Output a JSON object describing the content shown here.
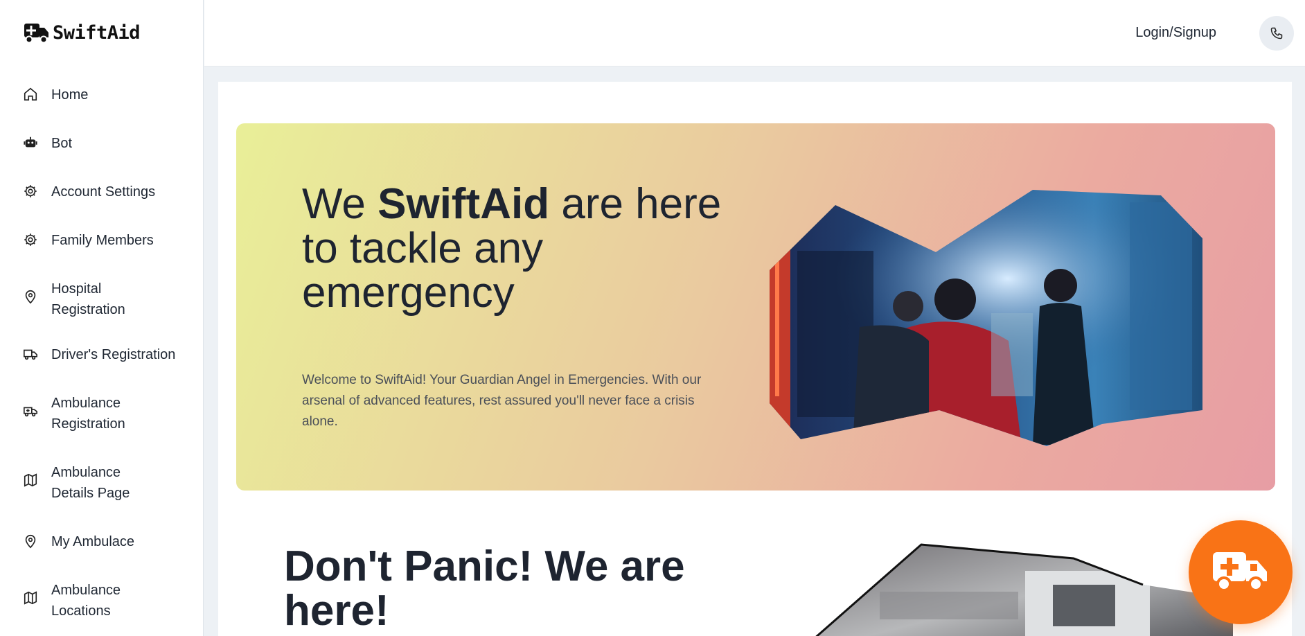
{
  "app": {
    "name": "SwiftAid",
    "brand_color": "#f97316"
  },
  "sidebar": {
    "items": [
      {
        "label": "Home",
        "icon": "home-icon"
      },
      {
        "label": "Bot",
        "icon": "bot-icon"
      },
      {
        "label": "Account Settings",
        "icon": "gear-icon"
      },
      {
        "label": "Family Members",
        "icon": "gear-icon"
      },
      {
        "label": "Hospital Registration",
        "icon": "map-pin-icon"
      },
      {
        "label": "Driver's Registration",
        "icon": "truck-icon"
      },
      {
        "label": "Ambulance Registration",
        "icon": "ambulance-icon"
      },
      {
        "label": "Ambulance Details Page",
        "icon": "map-icon"
      },
      {
        "label": "My Ambulace",
        "icon": "map-pin-icon"
      },
      {
        "label": "Ambulance Locations",
        "icon": "map-icon"
      }
    ]
  },
  "topbar": {
    "login_label": "Login/Signup",
    "phone_icon": "phone-icon"
  },
  "hero": {
    "title_pre": "We ",
    "title_bold": "SwiftAid",
    "title_post": " are here to tackle any emergency",
    "description": "Welcome to SwiftAid! Your Guardian Angel in Emergencies. With our arsenal of advanced features, rest assured you'll never face a crisis alone.",
    "gradient_colors": [
      "#e9ef98",
      "#eaca9f",
      "#ebaaa0",
      "#e79da4"
    ]
  },
  "section2": {
    "title": "Don't Panic! We are here!"
  },
  "fab": {
    "icon": "ambulance-icon"
  }
}
